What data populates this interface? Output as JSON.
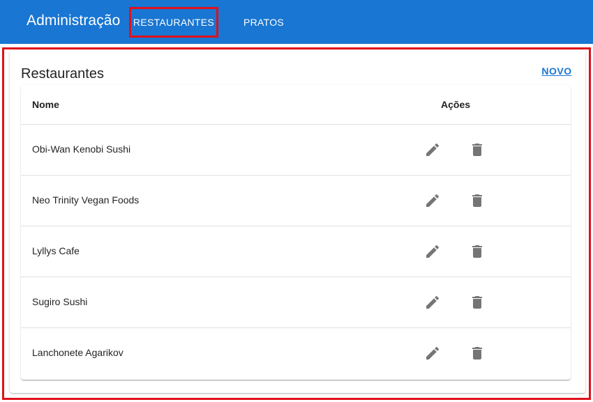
{
  "appbar": {
    "title": "Administração",
    "nav": [
      {
        "label": "RESTAURANTES"
      },
      {
        "label": "PRATOS"
      }
    ],
    "color": "#1976d2"
  },
  "main": {
    "title": "Restaurantes",
    "new_button": "NOVO",
    "table": {
      "headers": [
        "Nome",
        "Ações"
      ],
      "rows": [
        {
          "nome": "Obi-Wan Kenobi Sushi",
          "actions": [
            "pencil-icon",
            "trash-icon"
          ]
        },
        {
          "nome": "Neo Trinity Vegan Foods",
          "actions": [
            "pencil-icon",
            "trash-icon"
          ]
        },
        {
          "nome": "Lyllys Cafe",
          "actions": [
            "pencil-icon",
            "trash-icon"
          ]
        },
        {
          "nome": "Sugiro Sushi",
          "actions": [
            "pencil-icon",
            "trash-icon"
          ]
        },
        {
          "nome": "Lanchonete Agarikov",
          "actions": [
            "pencil-icon",
            "trash-icon"
          ]
        }
      ]
    }
  },
  "colors": {
    "highlight": "#e0101a",
    "icon": "#757575"
  }
}
